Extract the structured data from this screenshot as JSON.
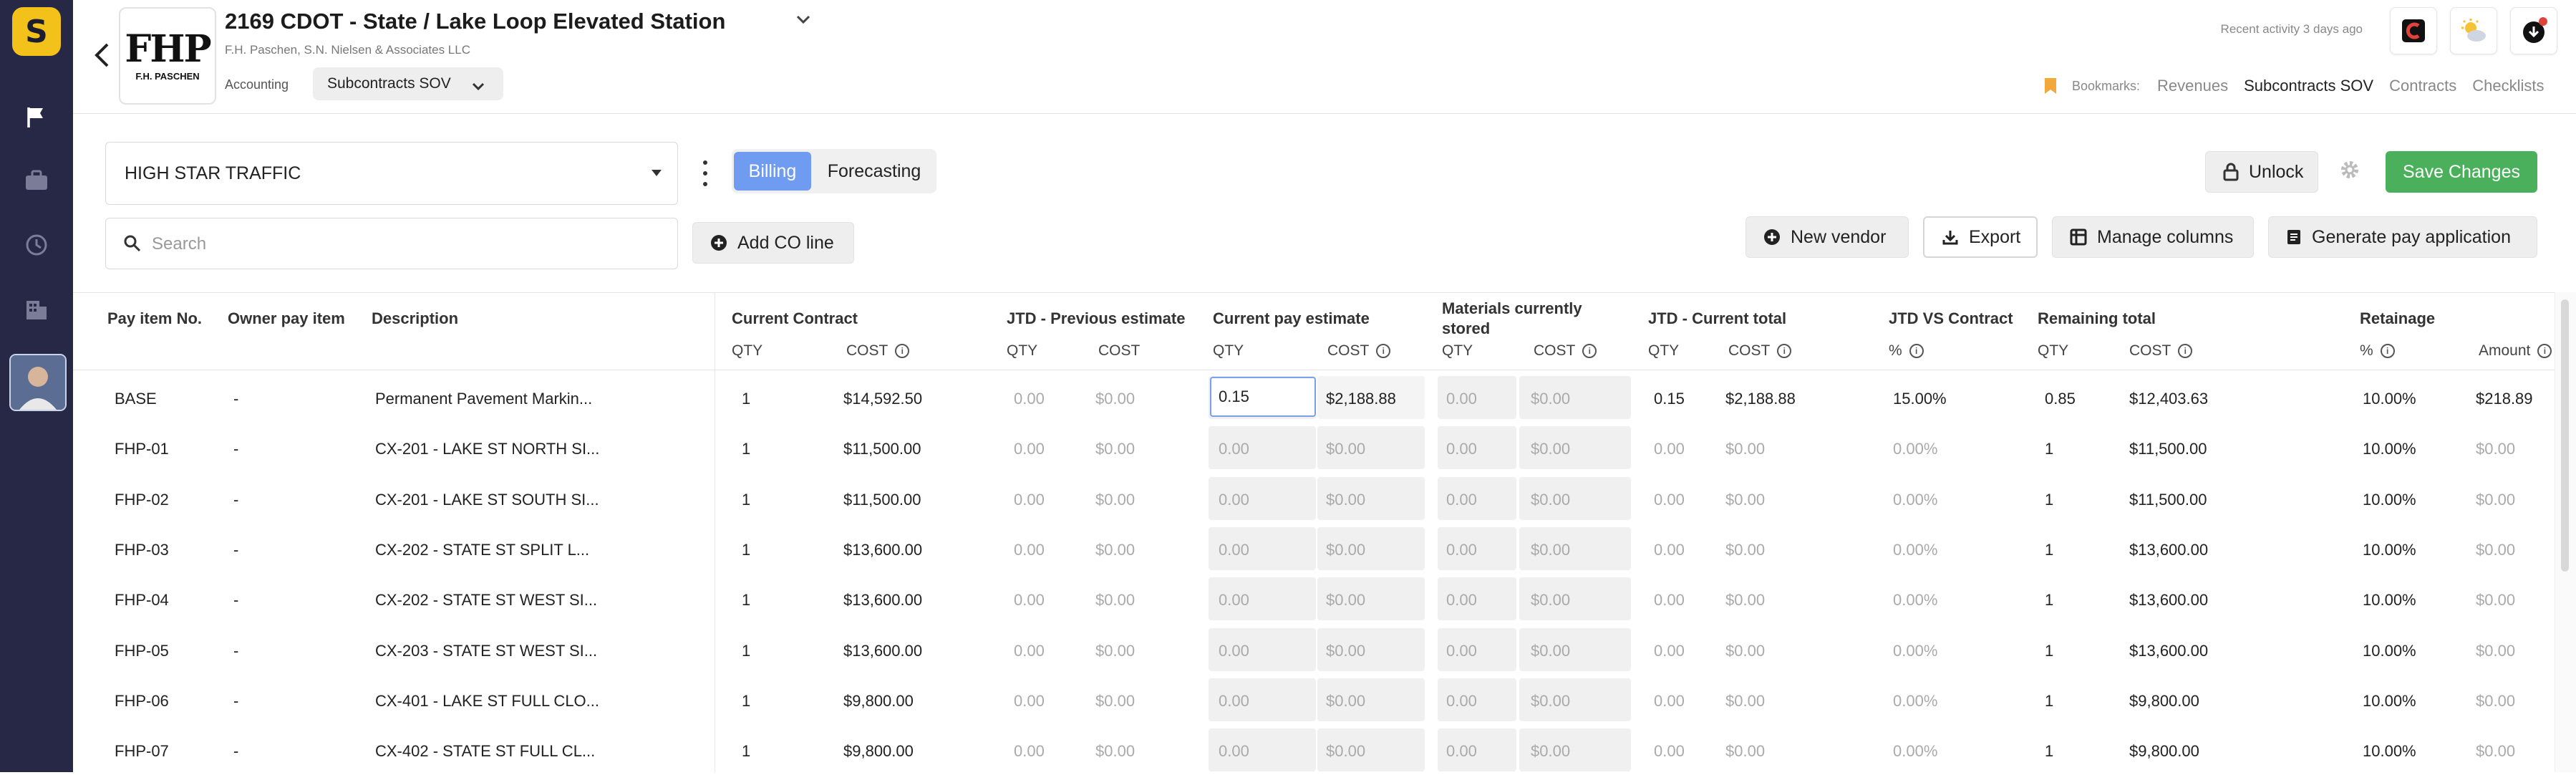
{
  "app": {
    "logo_letter": "S"
  },
  "header": {
    "title": "2169 CDOT - State / Lake Loop Elevated Station",
    "subtitle": "F.H. Paschen, S.N. Nielsen & Associates LLC",
    "company_logo_big": "FHP",
    "company_logo_small": "F.H. PASCHEN",
    "section_label": "Accounting",
    "section_select": "Subcontracts SOV",
    "recent_activity": "Recent activity 3 days ago",
    "bookmarks_label": "Bookmarks:",
    "bookmarks": [
      "Revenues",
      "Subcontracts SOV",
      "Contracts",
      "Checklists"
    ],
    "active_bookmark": "Subcontracts SOV"
  },
  "toolbar": {
    "vendor": "HIGH STAR TRAFFIC",
    "tabs": [
      "Billing",
      "Forecasting"
    ],
    "active_tab": "Billing",
    "unlock": "Unlock",
    "save": "Save Changes",
    "search_placeholder": "Search",
    "add_co_line": "Add CO line",
    "new_vendor": "New vendor",
    "export": "Export",
    "manage_columns": "Manage columns",
    "generate_pay_application": "Generate pay application"
  },
  "table": {
    "groups": {
      "pay_item_no": "Pay item No.",
      "owner_pay_item": "Owner pay item",
      "description": "Description",
      "current_contract": "Current Contract",
      "jtd_prev": "JTD - Previous estimate",
      "current_pay": "Current pay estimate",
      "materials_1": "Materials currently",
      "materials_2": "stored",
      "jtd_current": "JTD - Current total",
      "jtd_vs": "JTD VS Contract",
      "remaining": "Remaining total",
      "retainage": "Retainage"
    },
    "sub": {
      "qty": "QTY",
      "cost": "COST",
      "pct": "%",
      "amount": "Amount"
    },
    "rows": [
      {
        "no": "BASE",
        "owner": "-",
        "desc": "Permanent Pavement Markin...",
        "cc_qty": "1",
        "cc_cost": "$14,592.50",
        "prev_qty": "0.00",
        "prev_cost": "$0.00",
        "cur_qty": "0.15",
        "cur_cost": "$2,188.88",
        "mat_qty": "0.00",
        "mat_cost": "$0.00",
        "jtd_qty": "0.15",
        "jtd_cost": "$2,188.88",
        "vs_pct": "15.00%",
        "rem_qty": "0.85",
        "rem_cost": "$12,403.63",
        "ret_pct": "10.00%",
        "ret_amt": "$218.89",
        "active": true
      },
      {
        "no": "FHP-01",
        "owner": "-",
        "desc": "CX-201 - LAKE ST NORTH SI...",
        "cc_qty": "1",
        "cc_cost": "$11,500.00",
        "prev_qty": "0.00",
        "prev_cost": "$0.00",
        "cur_qty": "0.00",
        "cur_cost": "$0.00",
        "mat_qty": "0.00",
        "mat_cost": "$0.00",
        "jtd_qty": "0.00",
        "jtd_cost": "$0.00",
        "vs_pct": "0.00%",
        "rem_qty": "1",
        "rem_cost": "$11,500.00",
        "ret_pct": "10.00%",
        "ret_amt": "$0.00"
      },
      {
        "no": "FHP-02",
        "owner": "-",
        "desc": "CX-201 - LAKE ST SOUTH SI...",
        "cc_qty": "1",
        "cc_cost": "$11,500.00",
        "prev_qty": "0.00",
        "prev_cost": "$0.00",
        "cur_qty": "0.00",
        "cur_cost": "$0.00",
        "mat_qty": "0.00",
        "mat_cost": "$0.00",
        "jtd_qty": "0.00",
        "jtd_cost": "$0.00",
        "vs_pct": "0.00%",
        "rem_qty": "1",
        "rem_cost": "$11,500.00",
        "ret_pct": "10.00%",
        "ret_amt": "$0.00"
      },
      {
        "no": "FHP-03",
        "owner": "-",
        "desc": "CX-202 - STATE ST SPLIT L...",
        "cc_qty": "1",
        "cc_cost": "$13,600.00",
        "prev_qty": "0.00",
        "prev_cost": "$0.00",
        "cur_qty": "0.00",
        "cur_cost": "$0.00",
        "mat_qty": "0.00",
        "mat_cost": "$0.00",
        "jtd_qty": "0.00",
        "jtd_cost": "$0.00",
        "vs_pct": "0.00%",
        "rem_qty": "1",
        "rem_cost": "$13,600.00",
        "ret_pct": "10.00%",
        "ret_amt": "$0.00"
      },
      {
        "no": "FHP-04",
        "owner": "-",
        "desc": "CX-202 - STATE ST WEST SI...",
        "cc_qty": "1",
        "cc_cost": "$13,600.00",
        "prev_qty": "0.00",
        "prev_cost": "$0.00",
        "cur_qty": "0.00",
        "cur_cost": "$0.00",
        "mat_qty": "0.00",
        "mat_cost": "$0.00",
        "jtd_qty": "0.00",
        "jtd_cost": "$0.00",
        "vs_pct": "0.00%",
        "rem_qty": "1",
        "rem_cost": "$13,600.00",
        "ret_pct": "10.00%",
        "ret_amt": "$0.00"
      },
      {
        "no": "FHP-05",
        "owner": "-",
        "desc": "CX-203 - STATE ST WEST SI...",
        "cc_qty": "1",
        "cc_cost": "$13,600.00",
        "prev_qty": "0.00",
        "prev_cost": "$0.00",
        "cur_qty": "0.00",
        "cur_cost": "$0.00",
        "mat_qty": "0.00",
        "mat_cost": "$0.00",
        "jtd_qty": "0.00",
        "jtd_cost": "$0.00",
        "vs_pct": "0.00%",
        "rem_qty": "1",
        "rem_cost": "$13,600.00",
        "ret_pct": "10.00%",
        "ret_amt": "$0.00"
      },
      {
        "no": "FHP-06",
        "owner": "-",
        "desc": "CX-401 - LAKE ST FULL CLO...",
        "cc_qty": "1",
        "cc_cost": "$9,800.00",
        "prev_qty": "0.00",
        "prev_cost": "$0.00",
        "cur_qty": "0.00",
        "cur_cost": "$0.00",
        "mat_qty": "0.00",
        "mat_cost": "$0.00",
        "jtd_qty": "0.00",
        "jtd_cost": "$0.00",
        "vs_pct": "0.00%",
        "rem_qty": "1",
        "rem_cost": "$9,800.00",
        "ret_pct": "10.00%",
        "ret_amt": "$0.00"
      },
      {
        "no": "FHP-07",
        "owner": "-",
        "desc": "CX-402 - STATE ST FULL CL...",
        "cc_qty": "1",
        "cc_cost": "$9,800.00",
        "prev_qty": "0.00",
        "prev_cost": "$0.00",
        "cur_qty": "0.00",
        "cur_cost": "$0.00",
        "mat_qty": "0.00",
        "mat_cost": "$0.00",
        "jtd_qty": "0.00",
        "jtd_cost": "$0.00",
        "vs_pct": "0.00%",
        "rem_qty": "1",
        "rem_cost": "$9,800.00",
        "ret_pct": "10.00%",
        "ret_amt": "$0.00"
      }
    ]
  },
  "colors": {
    "rail": "#262846",
    "brand": "#f2c21b",
    "billing_tab": "#6f9bf1",
    "save": "#4bb05b",
    "bookmark": "#f2a83b"
  },
  "icons": [
    "flag-icon",
    "briefcase-icon",
    "history-icon",
    "building-icon",
    "back-arrow-icon",
    "chevron-down-icon",
    "lock-icon",
    "gear-icon",
    "search-icon",
    "plus-circle-icon",
    "download-icon",
    "columns-icon",
    "document-icon",
    "bookmark-icon",
    "info-icon",
    "kebab-icon"
  ]
}
